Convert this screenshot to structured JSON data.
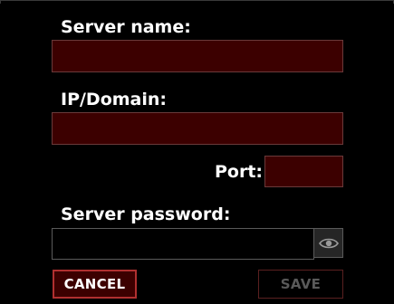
{
  "form": {
    "server_name": {
      "label": "Server name:",
      "value": ""
    },
    "ip_domain": {
      "label": "IP/Domain:",
      "value": ""
    },
    "port": {
      "label": "Port:",
      "value": ""
    },
    "server_password": {
      "label": "Server password:",
      "value": "",
      "toggle_icon": "eye-icon"
    }
  },
  "actions": {
    "cancel_label": "CANCEL",
    "save_label": "SAVE"
  },
  "colors": {
    "background": "#000000",
    "field_fill": "#3c0000",
    "field_border": "#6a3a3a",
    "cancel_border": "#b03030",
    "save_disabled_text": "#5a5a5a"
  }
}
